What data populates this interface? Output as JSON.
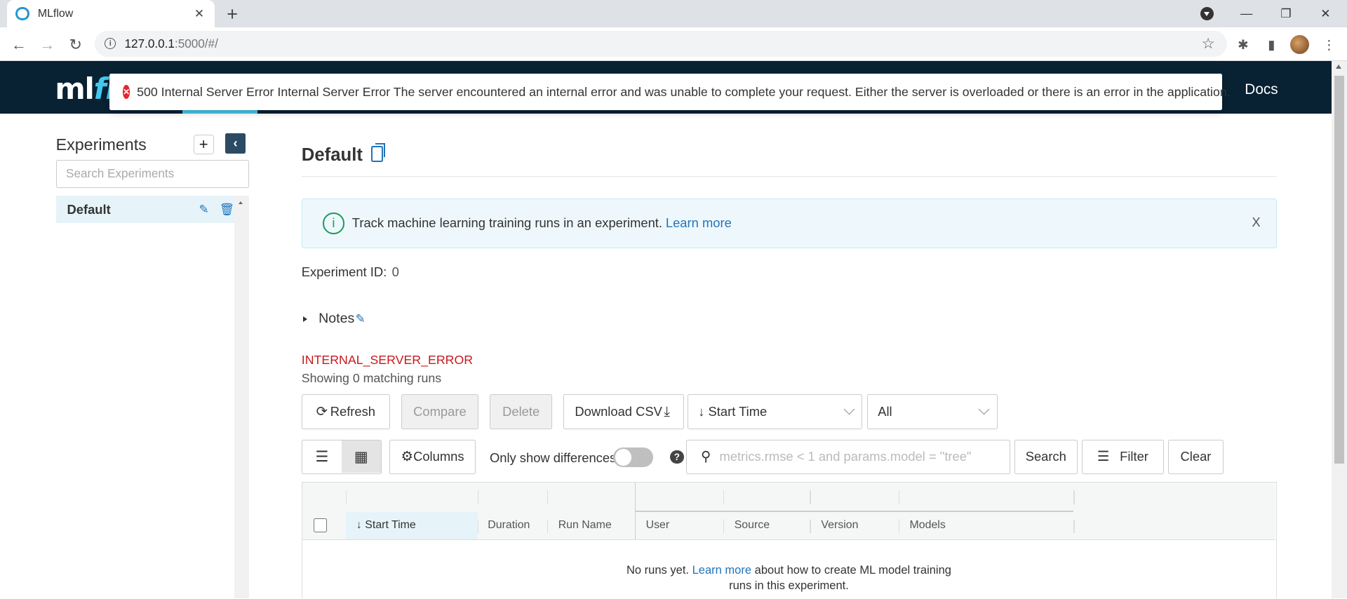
{
  "browser": {
    "tab_title": "MLflow",
    "tab_close": "✕",
    "new_tab": "+",
    "url_host": "127.0.0.1",
    "url_path": ":5000/#/"
  },
  "header": {
    "logo_ml": "ml",
    "logo_fl": "fl",
    "docs": "Docs"
  },
  "toast": {
    "message": "500 Internal Server Error Internal Server Error The server encountered an internal error and was unable to complete your request. Either the server is overloaded or there is an error in the application."
  },
  "sidebar": {
    "title": "Experiments",
    "add": "+",
    "collapse": "‹",
    "search_placeholder": "Search Experiments",
    "items": [
      {
        "label": "Default"
      }
    ]
  },
  "main": {
    "title": "Default",
    "banner": {
      "text": "Track machine learning training runs in an experiment.",
      "link": "Learn more",
      "close": "X"
    },
    "experiment_id_label": "Experiment ID:",
    "experiment_id": "0",
    "notes_label": "Notes",
    "error_code": "INTERNAL_SERVER_ERROR",
    "matching": "Showing 0 matching runs",
    "buttons": {
      "refresh": "Refresh",
      "compare": "Compare",
      "delete": "Delete",
      "download_csv": "Download CSV",
      "columns": "Columns",
      "search": "Search",
      "filter": "Filter",
      "clear": "Clear"
    },
    "sort_select": "↓ Start Time",
    "lifecycle_select": "All",
    "only_show_diff": "Only show differences",
    "search_placeholder": "metrics.rmse < 1 and params.model = \"tree\"",
    "table": {
      "columns": [
        "↓ Start Time",
        "Duration",
        "Run Name",
        "User",
        "Source",
        "Version",
        "Models"
      ]
    },
    "empty": {
      "before": "No runs yet.",
      "link": "Learn more",
      "after": "about how to create ML model training",
      "line2": "runs in this experiment."
    }
  },
  "colors": {
    "header_bg": "#082133",
    "accent": "#43c9ed",
    "link": "#2374bb",
    "error": "#c8191d"
  }
}
